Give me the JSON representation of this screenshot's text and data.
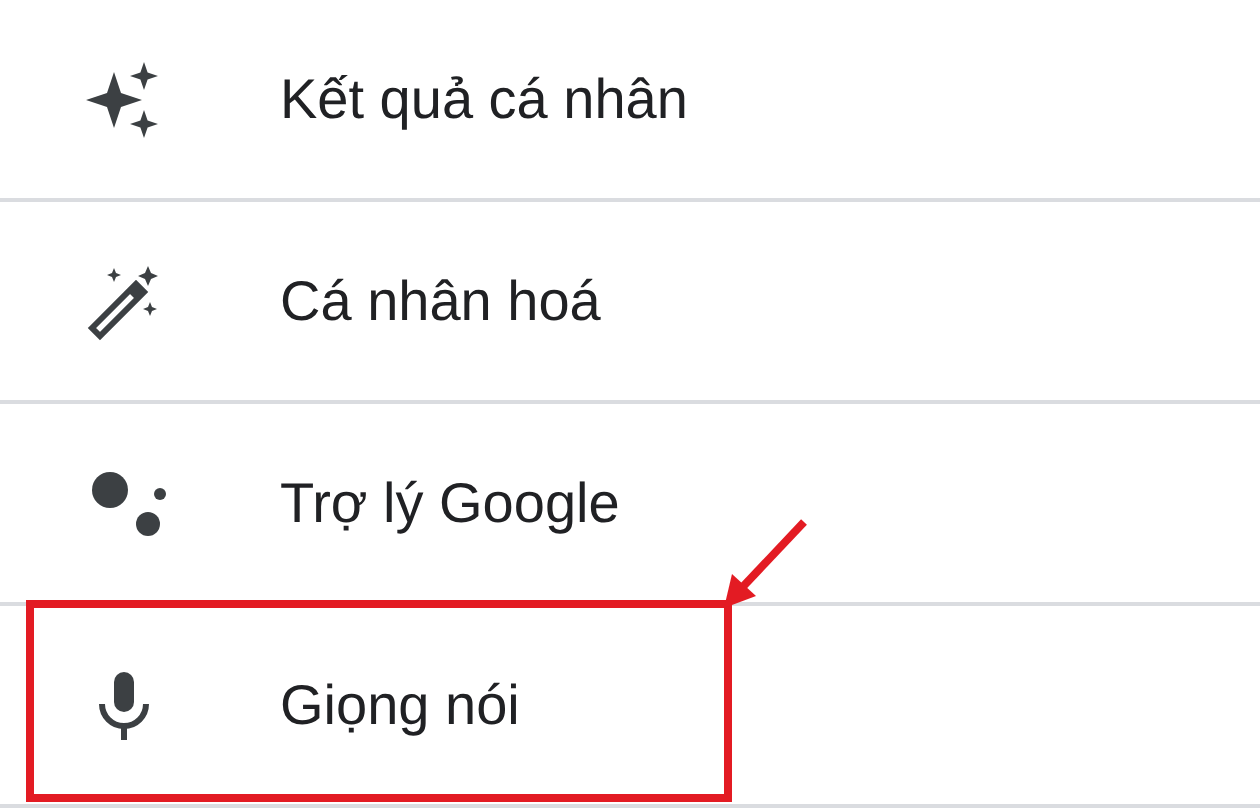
{
  "settings_items": [
    {
      "label": "Kết quả cá nhân",
      "highlighted": false
    },
    {
      "label": "Cá nhân hoá",
      "highlighted": false
    },
    {
      "label": "Trợ lý Google",
      "highlighted": false
    },
    {
      "label": "Giọng nói",
      "highlighted": true
    }
  ]
}
